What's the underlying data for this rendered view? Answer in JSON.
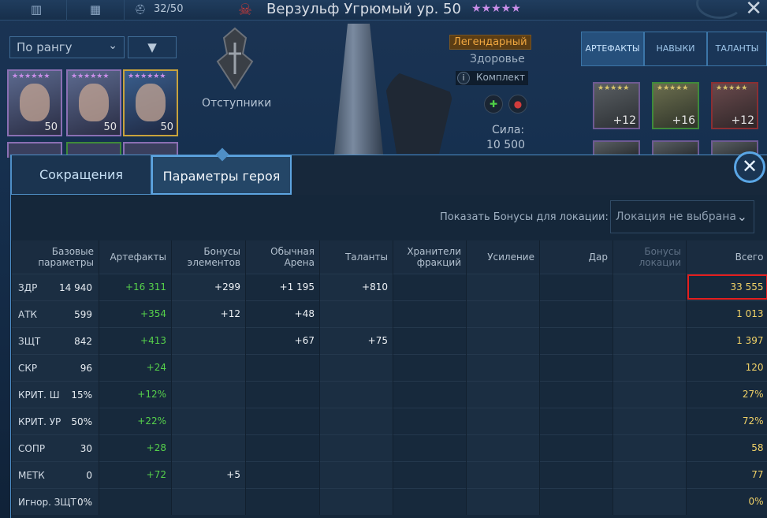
{
  "topbar": {
    "hero_count": "32/50",
    "hero_title": "Верзульф Угрюмый ур. 50",
    "stars": "★★★★★"
  },
  "roster": {
    "sort_label": "По рангу",
    "cards": [
      {
        "level": "50",
        "stars": "★★★★★★"
      },
      {
        "level": "50",
        "stars": "★★★★★★"
      },
      {
        "level": "50",
        "stars": "★★★★★★"
      }
    ]
  },
  "faction": {
    "name": "Отступники"
  },
  "hero_info": {
    "rarity": "Легендарный",
    "health_label": "Здоровье",
    "set_label": "Комплект",
    "power_label": "Сила:",
    "power_value": "10 500"
  },
  "side_tabs": [
    "АРТЕФАКТЫ",
    "НАВЫКИ",
    "ТАЛАНТЫ"
  ],
  "artifacts": [
    {
      "level": "+12",
      "stars": "★★★★★"
    },
    {
      "level": "+16",
      "stars": "★★★★★"
    },
    {
      "level": "+12",
      "stars": "★★★★★"
    }
  ],
  "modal": {
    "tabs": [
      "Сокращения",
      "Параметры героя"
    ],
    "location_label": "Показать Бонусы для локации:",
    "location_value": "Локация не выбрана",
    "headers": [
      "Базовые параметры",
      "Артефакты",
      "Бонусы элементов",
      "Обычная Арена",
      "Таланты",
      "Хранители фракций",
      "Усиление",
      "Дар",
      "Бонусы локации",
      "Всего"
    ],
    "rows": [
      {
        "name": "ЗДР",
        "base": "14 940",
        "artifacts": "+16 311",
        "elements": "+299",
        "arena": "+1 195",
        "talents": "+810",
        "total": "33 555"
      },
      {
        "name": "АТК",
        "base": "599",
        "artifacts": "+354",
        "elements": "+12",
        "arena": "+48",
        "talents": "",
        "total": "1 013"
      },
      {
        "name": "ЗЩТ",
        "base": "842",
        "artifacts": "+413",
        "elements": "",
        "arena": "+67",
        "talents": "+75",
        "total": "1 397"
      },
      {
        "name": "СКР",
        "base": "96",
        "artifacts": "+24",
        "elements": "",
        "arena": "",
        "talents": "",
        "total": "120"
      },
      {
        "name": "КРИТ. Ш",
        "base": "15%",
        "artifacts": "+12%",
        "elements": "",
        "arena": "",
        "talents": "",
        "total": "27%"
      },
      {
        "name": "КРИТ. УР",
        "base": "50%",
        "artifacts": "+22%",
        "elements": "",
        "arena": "",
        "talents": "",
        "total": "72%"
      },
      {
        "name": "СОПР",
        "base": "30",
        "artifacts": "+28",
        "elements": "",
        "arena": "",
        "talents": "",
        "total": "58"
      },
      {
        "name": "МЕТК",
        "base": "0",
        "artifacts": "+72",
        "elements": "+5",
        "arena": "",
        "talents": "",
        "total": "77"
      },
      {
        "name": "Игнор. ЗЩТ",
        "base": "0%",
        "artifacts": "",
        "elements": "",
        "arena": "",
        "talents": "",
        "total": "0%"
      }
    ]
  }
}
